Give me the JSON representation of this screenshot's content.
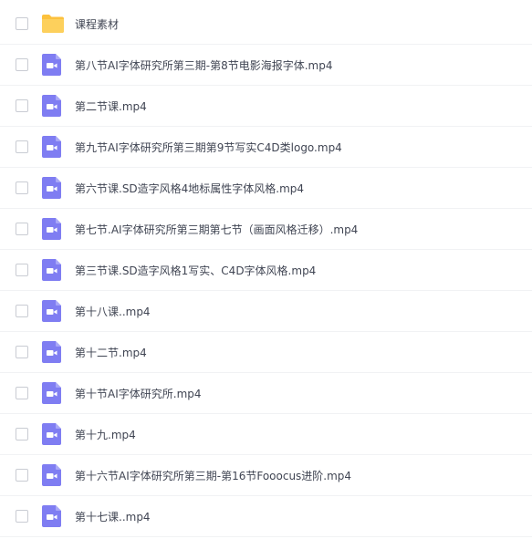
{
  "files": [
    {
      "name": "课程素材",
      "icon": "folder-icon"
    },
    {
      "name": "第八节AI字体研究所第三期-第8节电影海报字体.mp4",
      "icon": "video-file-icon"
    },
    {
      "name": "第二节课.mp4",
      "icon": "video-file-icon"
    },
    {
      "name": "第九节AI字体研究所第三期第9节写实C4D类logo.mp4",
      "icon": "video-file-icon"
    },
    {
      "name": "第六节课.SD造字风格4地标属性字体风格.mp4",
      "icon": "video-file-icon"
    },
    {
      "name": "第七节.AI字体研究所第三期第七节（画面风格迁移）.mp4",
      "icon": "video-file-icon"
    },
    {
      "name": "第三节课.SD造字风格1写实、C4D字体风格.mp4",
      "icon": "video-file-icon"
    },
    {
      "name": "第十八课..mp4",
      "icon": "video-file-icon"
    },
    {
      "name": "第十二节.mp4",
      "icon": "video-file-icon"
    },
    {
      "name": "第十节AI字体研究所.mp4",
      "icon": "video-file-icon"
    },
    {
      "name": "第十九.mp4",
      "icon": "video-file-icon"
    },
    {
      "name": "第十六节AI字体研究所第三期-第16节Fooocus进阶.mp4",
      "icon": "video-file-icon"
    },
    {
      "name": "第十七课..mp4",
      "icon": "video-file-icon"
    }
  ],
  "colors": {
    "folder": "#fcc13d",
    "video": "#7f7df2",
    "text": "#404553",
    "divider": "#f1f2f4"
  }
}
